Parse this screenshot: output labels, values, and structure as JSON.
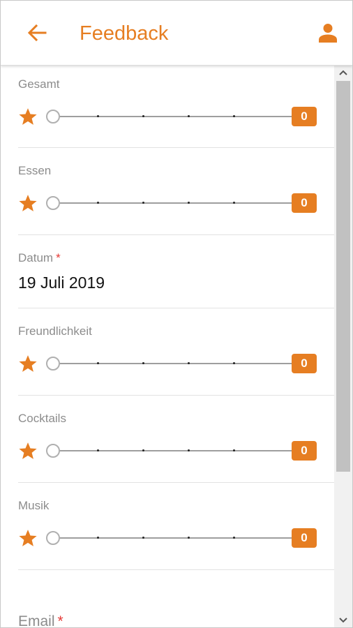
{
  "header": {
    "title": "Feedback",
    "back_icon": "arrow-left-icon",
    "user_icon": "person-icon"
  },
  "colors": {
    "accent": "#e67e22",
    "required": "#e53935"
  },
  "ratings": [
    {
      "label": "Gesamt",
      "value": "0"
    },
    {
      "label": "Essen",
      "value": "0"
    },
    {
      "label": "Freundlichkeit",
      "value": "0"
    },
    {
      "label": "Cocktails",
      "value": "0"
    },
    {
      "label": "Musik",
      "value": "0"
    }
  ],
  "date_field": {
    "label": "Datum",
    "required_mark": "*",
    "value": "19 Juli 2019"
  },
  "email_field": {
    "label": "Email",
    "required_mark": "*"
  },
  "scrollbar": {
    "up_icon": "chevron-up-icon",
    "down_icon": "chevron-down-icon"
  }
}
